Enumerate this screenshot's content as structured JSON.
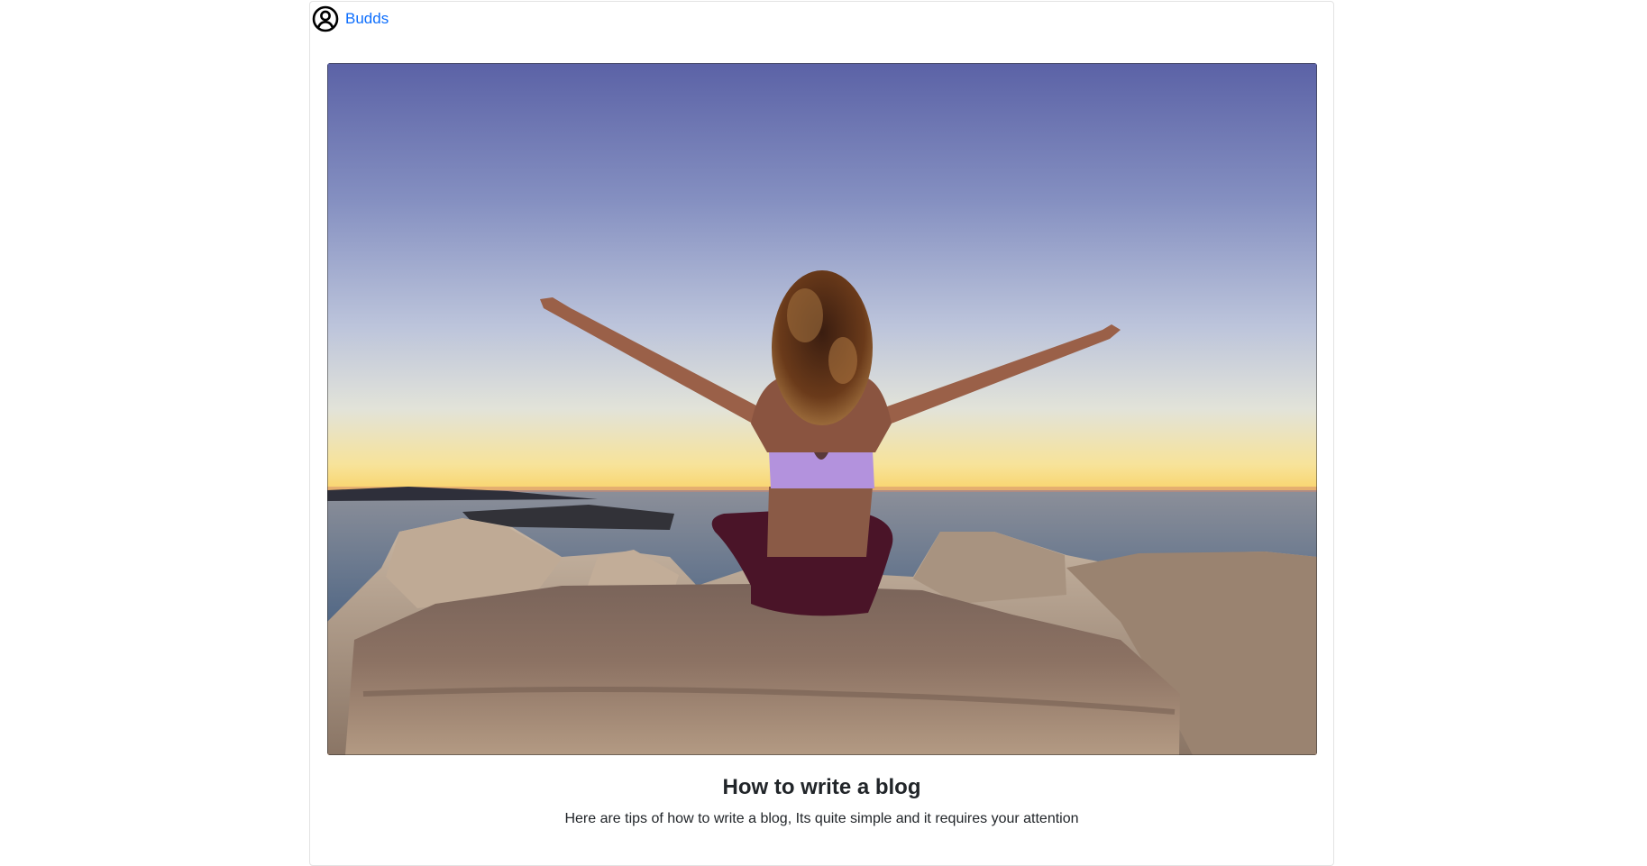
{
  "post": {
    "author": {
      "icon": "user-circle-icon",
      "name": "Budds"
    },
    "image": {
      "subject": "woman-arms-raised-on-rock-at-sunset"
    },
    "title": "How to write a blog",
    "description": "Here are tips of how to write a blog, Its quite simple and it requires your attention"
  },
  "colors": {
    "link": "#0d6efd",
    "text": "#212529",
    "border": "#e3e3e3"
  }
}
